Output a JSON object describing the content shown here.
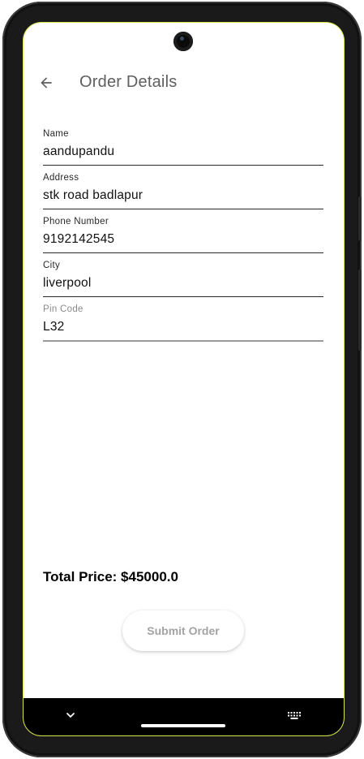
{
  "app_bar": {
    "title": "Order Details",
    "back_icon": "arrow-back-icon"
  },
  "form": {
    "fields": [
      {
        "label": "Name",
        "value": "aandupandu"
      },
      {
        "label": "Address",
        "value": "stk road badlapur"
      },
      {
        "label": "Phone Number",
        "value": "9192142545"
      },
      {
        "label": "City",
        "value": "liverpool"
      },
      {
        "label": "Pin Code",
        "value": "L32"
      }
    ]
  },
  "summary": {
    "total_label": "Total Price: $45000.0"
  },
  "actions": {
    "submit_label": "Submit Order"
  },
  "system_nav": {
    "icons": [
      "chevron-down-icon",
      "home-pill-icon",
      "keyboard-icon"
    ]
  },
  "colors": {
    "title_text": "#5f5f5f",
    "muted_label": "#8a8a8a",
    "submit_text": "#a3a3a3",
    "nav_bar": "#000000"
  }
}
